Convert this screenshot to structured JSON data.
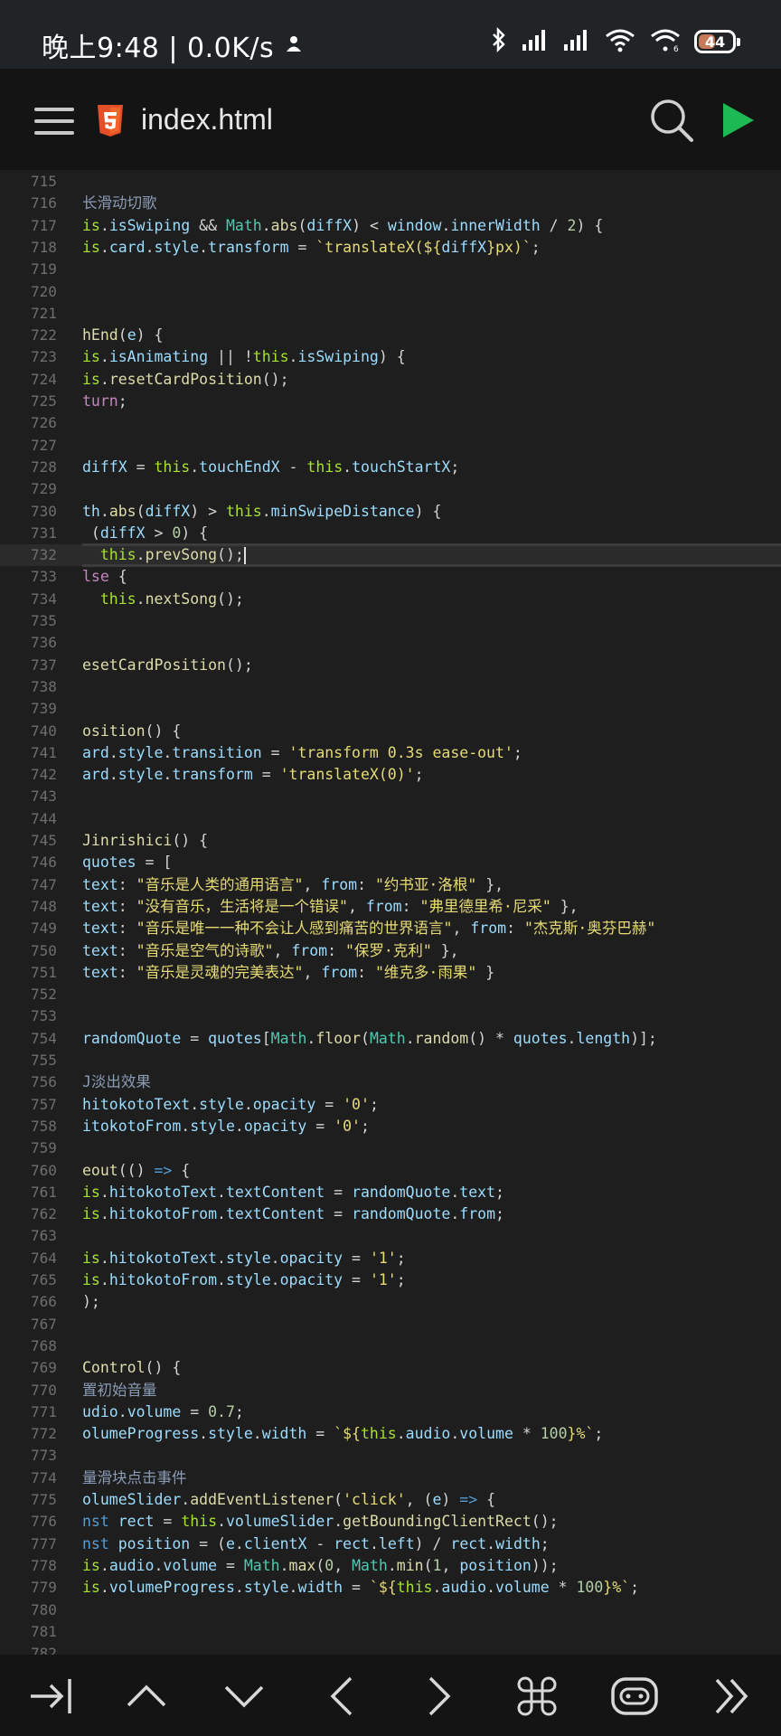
{
  "status_bar": {
    "time_text": "晚上9:48 | 0.0K/s",
    "battery_level": "44"
  },
  "app_bar": {
    "file_name": "index.html",
    "file_icon": "html5-icon",
    "accent_color": "#1db954"
  },
  "editor": {
    "current_line": "732",
    "lines": [
      {
        "n": "715",
        "c": ""
      },
      {
        "n": "716",
        "c": "<span class='t-cm'>长滑动切歌</span>"
      },
      {
        "n": "717",
        "c": "<span class='t-this'>is</span>.<span class='t-id'>isSwiping</span> &amp;&amp; <span class='t-cls'>Math</span>.<span class='t-fn'>abs</span>(<span class='t-id'>diffX</span>) &lt; <span class='t-id'>window</span>.<span class='t-id'>innerWidth</span> / <span class='t-num'>2</span>) {"
      },
      {
        "n": "718",
        "c": "<span class='t-this'>is</span>.<span class='t-id'>card</span>.<span class='t-id'>style</span>.<span class='t-id'>transform</span> = <span class='t-ystr'>`translateX(${</span><span class='t-id'>diffX</span><span class='t-ystr'>}px)`</span>;"
      },
      {
        "n": "719",
        "c": ""
      },
      {
        "n": "720",
        "c": ""
      },
      {
        "n": "721",
        "c": ""
      },
      {
        "n": "722",
        "c": "<span class='t-fn'>hEnd</span>(<span class='t-id'>e</span>) {"
      },
      {
        "n": "723",
        "c": "<span class='t-this'>is</span>.<span class='t-id'>isAnimating</span> || !<span class='t-this'>this</span>.<span class='t-id'>isSwiping</span>) {"
      },
      {
        "n": "724",
        "c": "<span class='t-this'>is</span>.<span class='t-fn'>resetCardPosition</span>();"
      },
      {
        "n": "725",
        "c": "<span class='t-kw'>turn</span>;"
      },
      {
        "n": "726",
        "c": ""
      },
      {
        "n": "727",
        "c": ""
      },
      {
        "n": "728",
        "c": "<span class='t-id'>diffX</span> = <span class='t-this'>this</span>.<span class='t-id'>touchEndX</span> - <span class='t-this'>this</span>.<span class='t-id'>touchStartX</span>;"
      },
      {
        "n": "729",
        "c": ""
      },
      {
        "n": "730",
        "c": "<span class='t-id'>th</span>.<span class='t-fn'>abs</span>(<span class='t-id'>diffX</span>) &gt; <span class='t-this'>this</span>.<span class='t-id'>minSwipeDistance</span>) {"
      },
      {
        "n": "731",
        "c": " (<span class='t-id'>diffX</span> &gt; <span class='t-num'>0</span>) {"
      },
      {
        "n": "732",
        "c": "  <span class='t-this'>this</span>.<span class='t-fn'>prevSong</span>();<span class='caret'></span>"
      },
      {
        "n": "733",
        "c": "<span class='t-kw'>lse</span> {"
      },
      {
        "n": "734",
        "c": "  <span class='t-this'>this</span>.<span class='t-fn'>nextSong</span>();"
      },
      {
        "n": "735",
        "c": ""
      },
      {
        "n": "736",
        "c": ""
      },
      {
        "n": "737",
        "c": "<span class='t-fn'>esetCardPosition</span>();"
      },
      {
        "n": "738",
        "c": ""
      },
      {
        "n": "739",
        "c": ""
      },
      {
        "n": "740",
        "c": "<span class='t-fn'>osition</span>() {"
      },
      {
        "n": "741",
        "c": "<span class='t-id'>ard</span>.<span class='t-id'>style</span>.<span class='t-id'>transition</span> = <span class='t-ystr'>'transform 0.3s ease-out'</span>;"
      },
      {
        "n": "742",
        "c": "<span class='t-id'>ard</span>.<span class='t-id'>style</span>.<span class='t-id'>transform</span> = <span class='t-ystr'>'translateX(0)'</span>;"
      },
      {
        "n": "743",
        "c": ""
      },
      {
        "n": "744",
        "c": ""
      },
      {
        "n": "745",
        "c": "<span class='t-fn'>Jinrishici</span>() {"
      },
      {
        "n": "746",
        "c": "<span class='t-id'>quotes</span> = ["
      },
      {
        "n": "747",
        "c": "<span class='t-id'>text</span>: <span class='t-ystr'>\"音乐是人类的通用语言\"</span>, <span class='t-id'>from</span>: <span class='t-ystr'>\"约书亚·洛根\"</span> },"
      },
      {
        "n": "748",
        "c": "<span class='t-id'>text</span>: <span class='t-ystr'>\"没有音乐，生活将是一个错误\"</span>, <span class='t-id'>from</span>: <span class='t-ystr'>\"弗里德里希·尼采\"</span> },"
      },
      {
        "n": "749",
        "c": "<span class='t-id'>text</span>: <span class='t-ystr'>\"音乐是唯一一种不会让人感到痛苦的世界语言\"</span>, <span class='t-id'>from</span>: <span class='t-ystr'>\"杰克斯·奥芬巴赫\"</span>"
      },
      {
        "n": "750",
        "c": "<span class='t-id'>text</span>: <span class='t-ystr'>\"音乐是空气的诗歌\"</span>, <span class='t-id'>from</span>: <span class='t-ystr'>\"保罗·克利\"</span> },"
      },
      {
        "n": "751",
        "c": "<span class='t-id'>text</span>: <span class='t-ystr'>\"音乐是灵魂的完美表达\"</span>, <span class='t-id'>from</span>: <span class='t-ystr'>\"维克多·雨果\"</span> }"
      },
      {
        "n": "752",
        "c": ""
      },
      {
        "n": "753",
        "c": ""
      },
      {
        "n": "754",
        "c": "<span class='t-id'>randomQuote</span> = <span class='t-id'>quotes</span>[<span class='t-cls'>Math</span>.<span class='t-fn'>floor</span>(<span class='t-cls'>Math</span>.<span class='t-fn'>random</span>() * <span class='t-id'>quotes</span>.<span class='t-id'>length</span>)];"
      },
      {
        "n": "755",
        "c": ""
      },
      {
        "n": "756",
        "c": "<span class='t-cm'>J淡出效果</span>"
      },
      {
        "n": "757",
        "c": "<span class='t-id'>hitokotoText</span>.<span class='t-id'>style</span>.<span class='t-id'>opacity</span> = <span class='t-ystr'>'0'</span>;"
      },
      {
        "n": "758",
        "c": "<span class='t-id'>itokotoFrom</span>.<span class='t-id'>style</span>.<span class='t-id'>opacity</span> = <span class='t-ystr'>'0'</span>;"
      },
      {
        "n": "759",
        "c": ""
      },
      {
        "n": "760",
        "c": "<span class='t-fn'>eout</span>(() <span class='t-kw2'>=&gt;</span> {"
      },
      {
        "n": "761",
        "c": "<span class='t-this'>is</span>.<span class='t-id'>hitokotoText</span>.<span class='t-id'>textContent</span> = <span class='t-id'>randomQuote</span>.<span class='t-id'>text</span>;"
      },
      {
        "n": "762",
        "c": "<span class='t-this'>is</span>.<span class='t-id'>hitokotoFrom</span>.<span class='t-id'>textContent</span> = <span class='t-id'>randomQuote</span>.<span class='t-id'>from</span>;"
      },
      {
        "n": "763",
        "c": ""
      },
      {
        "n": "764",
        "c": "<span class='t-this'>is</span>.<span class='t-id'>hitokotoText</span>.<span class='t-id'>style</span>.<span class='t-id'>opacity</span> = <span class='t-ystr'>'1'</span>;"
      },
      {
        "n": "765",
        "c": "<span class='t-this'>is</span>.<span class='t-id'>hitokotoFrom</span>.<span class='t-id'>style</span>.<span class='t-id'>opacity</span> = <span class='t-ystr'>'1'</span>;"
      },
      {
        "n": "766",
        "c": ");"
      },
      {
        "n": "767",
        "c": ""
      },
      {
        "n": "768",
        "c": ""
      },
      {
        "n": "769",
        "c": "<span class='t-fn'>Control</span>() {"
      },
      {
        "n": "770",
        "c": "<span class='t-cm'>置初始音量</span>"
      },
      {
        "n": "771",
        "c": "<span class='t-id'>udio</span>.<span class='t-id'>volume</span> = <span class='t-num'>0.7</span>;"
      },
      {
        "n": "772",
        "c": "<span class='t-id'>olumeProgress</span>.<span class='t-id'>style</span>.<span class='t-id'>width</span> = <span class='t-ystr'>`${</span><span class='t-this'>this</span>.<span class='t-id'>audio</span>.<span class='t-id'>volume</span> * <span class='t-num'>100</span><span class='t-ystr'>}%`</span>;"
      },
      {
        "n": "773",
        "c": ""
      },
      {
        "n": "774",
        "c": "<span class='t-cm'>量滑块点击事件</span>"
      },
      {
        "n": "775",
        "c": "<span class='t-id'>olumeSlider</span>.<span class='t-fn'>addEventListener</span>(<span class='t-ystr'>'click'</span>, (<span class='t-id'>e</span>) <span class='t-kw2'>=&gt;</span> {"
      },
      {
        "n": "776",
        "c": "<span class='t-kw2'>nst</span> <span class='t-id'>rect</span> = <span class='t-this'>this</span>.<span class='t-id'>volumeSlider</span>.<span class='t-fn'>getBoundingClientRect</span>();"
      },
      {
        "n": "777",
        "c": "<span class='t-kw2'>nst</span> <span class='t-id'>position</span> = (<span class='t-id'>e</span>.<span class='t-id'>clientX</span> - <span class='t-id'>rect</span>.<span class='t-id'>left</span>) / <span class='t-id'>rect</span>.<span class='t-id'>width</span>;"
      },
      {
        "n": "778",
        "c": "<span class='t-this'>is</span>.<span class='t-id'>audio</span>.<span class='t-id'>volume</span> = <span class='t-cls'>Math</span>.<span class='t-fn'>max</span>(<span class='t-num'>0</span>, <span class='t-cls'>Math</span>.<span class='t-fn'>min</span>(<span class='t-num'>1</span>, <span class='t-id'>position</span>));"
      },
      {
        "n": "779",
        "c": "<span class='t-this'>is</span>.<span class='t-id'>volumeProgress</span>.<span class='t-id'>style</span>.<span class='t-id'>width</span> = <span class='t-ystr'>`${</span><span class='t-this'>this</span>.<span class='t-id'>audio</span>.<span class='t-id'>volume</span> * <span class='t-num'>100</span><span class='t-ystr'>}%`</span>;"
      },
      {
        "n": "780",
        "c": ""
      },
      {
        "n": "781",
        "c": ""
      },
      {
        "n": "782",
        "c": ""
      }
    ]
  },
  "toolbar": {
    "buttons": [
      {
        "icon": "tab-indent-icon"
      },
      {
        "icon": "chevron-up-icon"
      },
      {
        "icon": "chevron-down-icon"
      },
      {
        "icon": "chevron-left-icon"
      },
      {
        "icon": "chevron-right-icon"
      },
      {
        "icon": "command-icon"
      },
      {
        "icon": "ai-assistant-icon"
      },
      {
        "icon": "double-chevron-right-icon"
      }
    ]
  }
}
